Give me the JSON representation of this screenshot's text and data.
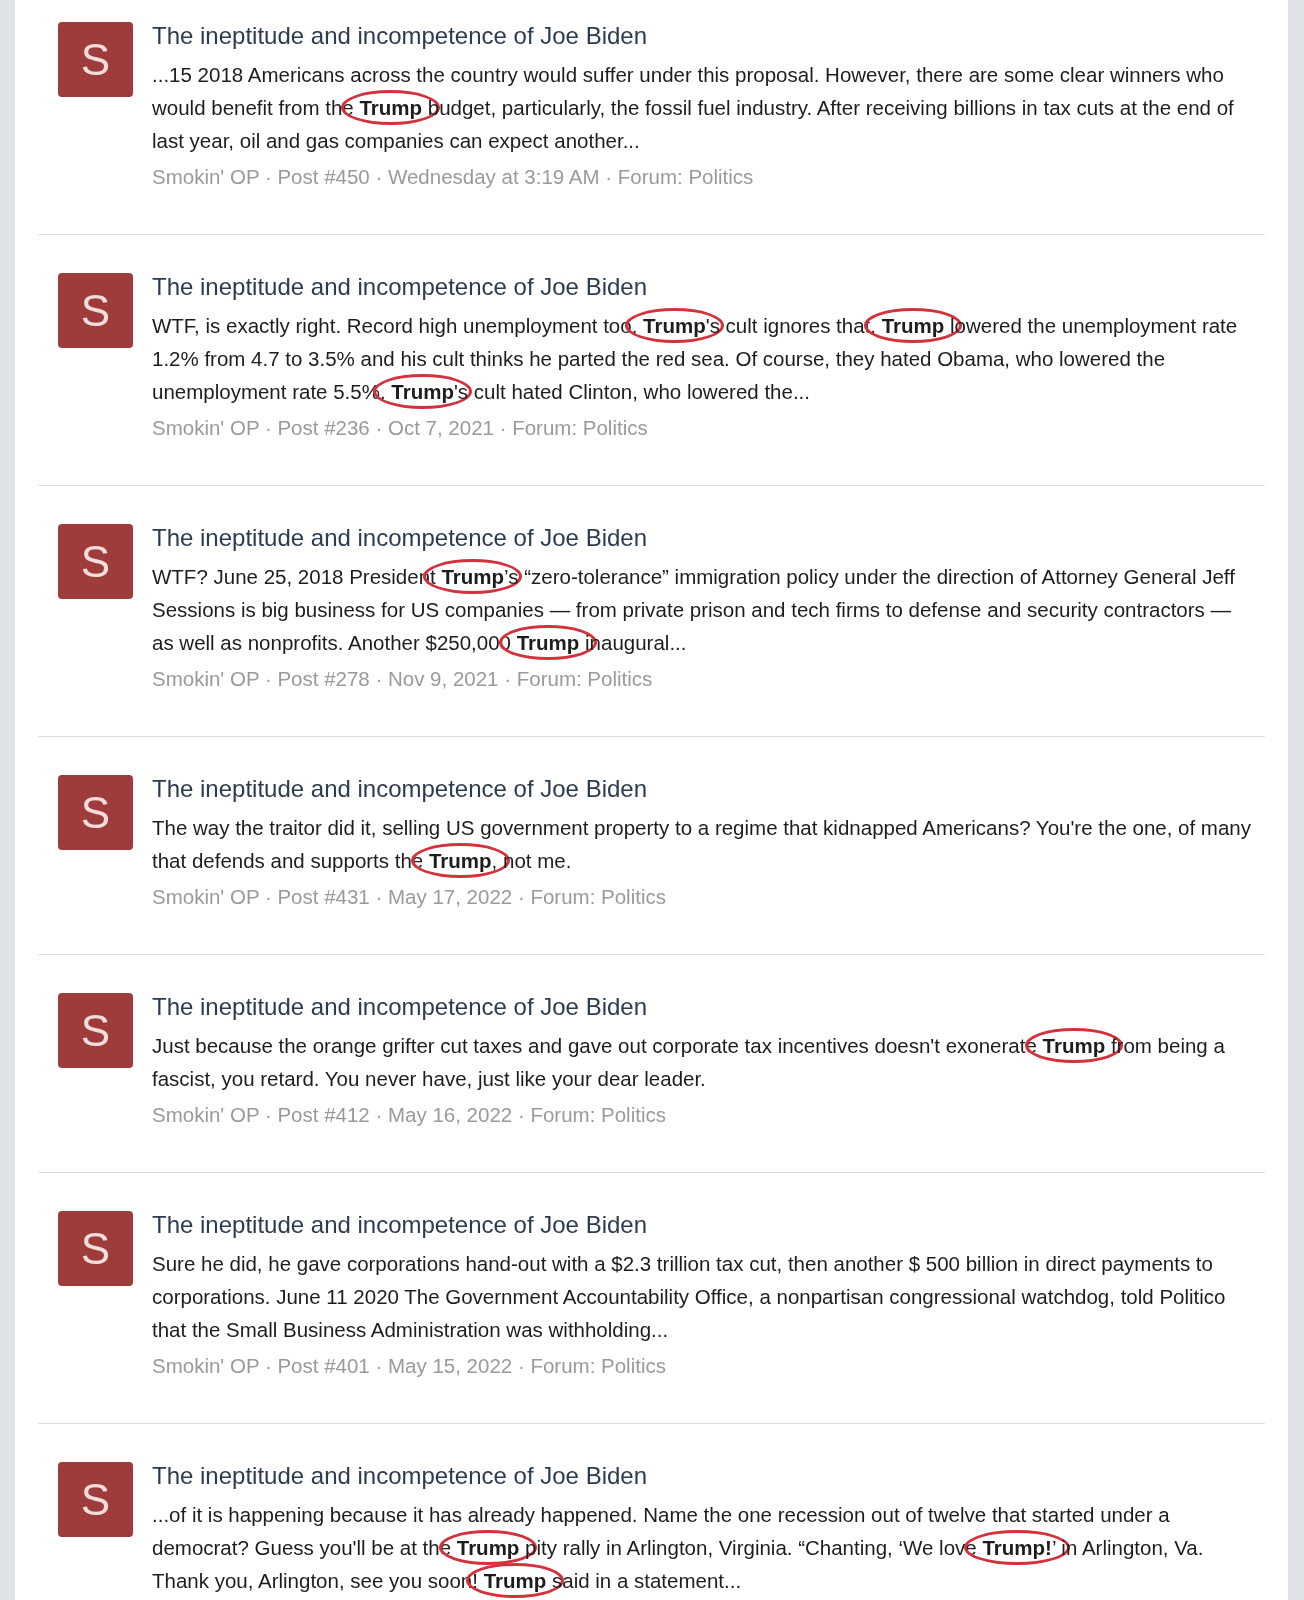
{
  "results": [
    {
      "avatar_letter": "S",
      "title": "The ineptitude and incompetence of Joe Biden",
      "snippet": [
        {
          "text": "...15 2018 Americans across the country would suffer under this proposal. However, there are some clear winners who would benefit from the ",
          "bold": false,
          "circled": false
        },
        {
          "text": "Trump",
          "bold": true,
          "circled": true
        },
        {
          "text": " budget, particularly, the fossil fuel industry. After receiving billions in tax cuts at the end of last year, oil and gas companies can expect another...",
          "bold": false,
          "circled": false
        }
      ],
      "meta": "Smokin' OP · Post #450 · Wednesday at 3:19 AM · Forum: Politics"
    },
    {
      "avatar_letter": "S",
      "title": "The ineptitude and incompetence of Joe Biden",
      "snippet": [
        {
          "text": "WTF, is exactly right. Record high unemployment too. ",
          "bold": false,
          "circled": false
        },
        {
          "text": "Trump",
          "bold": true,
          "circled": true
        },
        {
          "text": "'s cult ignores that. ",
          "bold": false,
          "circled": false
        },
        {
          "text": "Trump",
          "bold": true,
          "circled": true
        },
        {
          "text": " lowered the unemployment rate 1.2% from 4.7 to 3.5% and his cult thinks he parted the red sea. Of course, they hated Obama, who lowered the unemployment rate 5.5%. ",
          "bold": false,
          "circled": false
        },
        {
          "text": "Trump",
          "bold": true,
          "circled": true
        },
        {
          "text": "'s cult hated Clinton, who lowered the...",
          "bold": false,
          "circled": false
        }
      ],
      "meta": "Smokin' OP · Post #236 · Oct 7, 2021 · Forum: Politics"
    },
    {
      "avatar_letter": "S",
      "title": "The ineptitude and incompetence of Joe Biden",
      "snippet": [
        {
          "text": "WTF? June 25, 2018 President ",
          "bold": false,
          "circled": false
        },
        {
          "text": "Trump",
          "bold": true,
          "circled": true
        },
        {
          "text": "’s “zero-tolerance” immigration policy under the direction of Attorney General Jeff Sessions is big business for US companies — from private prison and tech firms to defense and security contractors — as well as nonprofits. Another $250,000 ",
          "bold": false,
          "circled": false
        },
        {
          "text": "Trump",
          "bold": true,
          "circled": true
        },
        {
          "text": " inaugural...",
          "bold": false,
          "circled": false
        }
      ],
      "meta": "Smokin' OP · Post #278 · Nov 9, 2021 · Forum: Politics"
    },
    {
      "avatar_letter": "S",
      "title": "The ineptitude and incompetence of Joe Biden",
      "snippet": [
        {
          "text": "The way the traitor did it, selling US government property to a regime that kidnapped Americans? You're the one, of many that defends and supports the ",
          "bold": false,
          "circled": false
        },
        {
          "text": "Trump",
          "bold": true,
          "circled": true
        },
        {
          "text": ", not me.",
          "bold": false,
          "circled": false
        }
      ],
      "meta": "Smokin' OP · Post #431 · May 17, 2022 · Forum: Politics"
    },
    {
      "avatar_letter": "S",
      "title": "The ineptitude and incompetence of Joe Biden",
      "snippet": [
        {
          "text": "Just because the orange grifter cut taxes and gave out corporate tax incentives doesn't exonerate ",
          "bold": false,
          "circled": false
        },
        {
          "text": "Trump",
          "bold": true,
          "circled": true
        },
        {
          "text": " from being a fascist, you retard. You never have, just like your dear leader.",
          "bold": false,
          "circled": false
        }
      ],
      "meta": "Smokin' OP · Post #412 · May 16, 2022 · Forum: Politics"
    },
    {
      "avatar_letter": "S",
      "title": "The ineptitude and incompetence of Joe Biden",
      "snippet": [
        {
          "text": "Sure he did, he gave corporations hand-out with a $2.3 trillion tax cut, then another $ 500 billion in direct payments to corporations. June 11 2020 The Government Accountability Office, a nonpartisan congressional watchdog, told Politico that the Small Business Administration was withholding...",
          "bold": false,
          "circled": false
        }
      ],
      "meta": "Smokin' OP · Post #401 · May 15, 2022 · Forum: Politics"
    },
    {
      "avatar_letter": "S",
      "title": "The ineptitude and incompetence of Joe Biden",
      "snippet": [
        {
          "text": "...of it is happening because it has already happened. Name the one recession out of twelve that started under a democrat? Guess you'll be at the ",
          "bold": false,
          "circled": false
        },
        {
          "text": "Trump",
          "bold": true,
          "circled": true
        },
        {
          "text": " pity rally in Arlington, Virginia. “Chanting, ‘We love ",
          "bold": false,
          "circled": false
        },
        {
          "text": "Trump!",
          "bold": true,
          "circled": true
        },
        {
          "text": "’ in Arlington, Va. Thank you, Arlington, see you soon! ",
          "bold": false,
          "circled": false
        },
        {
          "text": "Trump",
          "bold": true,
          "circled": true
        },
        {
          "text": " said in a statement...",
          "bold": false,
          "circled": false
        }
      ]
    }
  ]
}
